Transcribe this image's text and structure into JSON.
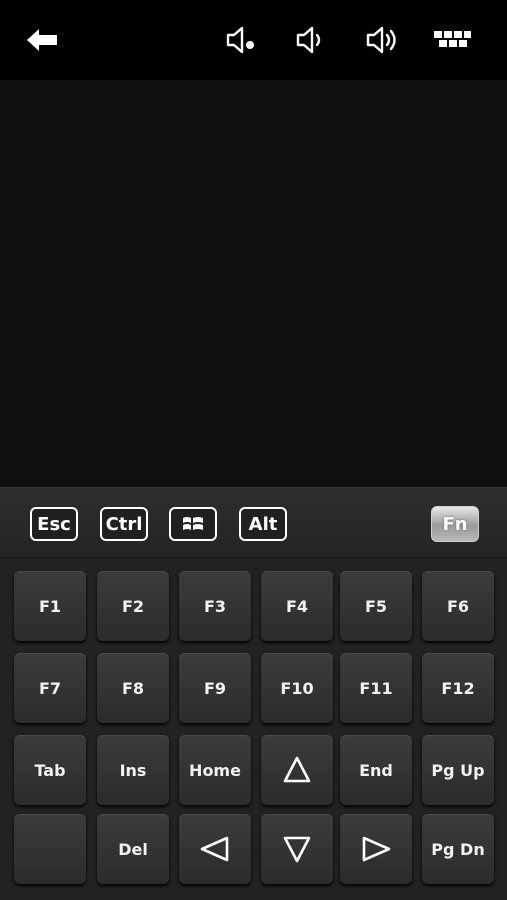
{
  "topbar": {
    "icons": [
      "back-arrow-icon",
      "volume-mute-icon",
      "volume-down-icon",
      "volume-up-icon",
      "keyboard-icon"
    ]
  },
  "modifiers": {
    "esc": "Esc",
    "ctrl": "Ctrl",
    "win": "windows-logo-icon",
    "alt": "Alt",
    "fn": "Fn"
  },
  "keys": [
    [
      "F1",
      "F2",
      "F3",
      "F4",
      "F5",
      "F6"
    ],
    [
      "F7",
      "F8",
      "F9",
      "F10",
      "F11",
      "F12"
    ],
    [
      "Tab",
      "Ins",
      "Home",
      "arrow-up-icon",
      "End",
      "Pg Up"
    ],
    [
      "",
      "Del",
      "arrow-left-icon",
      "arrow-down-icon",
      "arrow-right-icon",
      "Pg Dn"
    ]
  ],
  "colors": {
    "background": "#000000",
    "touchpad": "#0f0f0f",
    "key": "#333333",
    "text": "#ffffff",
    "fn_active": "#b0b0b0"
  }
}
